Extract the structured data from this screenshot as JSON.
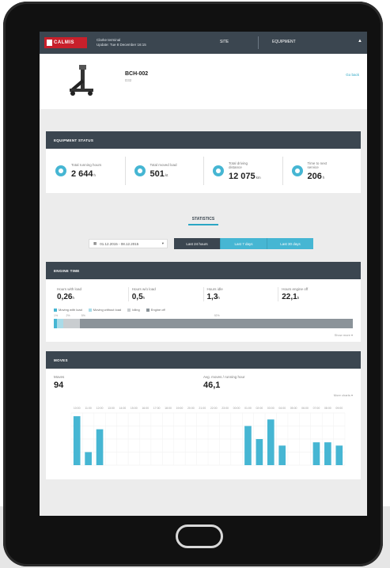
{
  "app": {
    "logo_text": "CALMIS",
    "site_name": "Clarke terminal",
    "site_updated": "Update: Tue 8 December 16:15",
    "nav": {
      "site": "SITE",
      "equipment": "EQUIPMENT"
    }
  },
  "equipment": {
    "id": "BCH-002",
    "model": "D32",
    "go_back": "Go back"
  },
  "status": {
    "title": "EQUIPMENT STATUS",
    "kpis": [
      {
        "label": "Total running hours",
        "value": "2 644",
        "unit": "h",
        "icon": "clock-icon"
      },
      {
        "label": "Total moved load",
        "value": "501",
        "unit": "kt",
        "icon": "load-icon"
      },
      {
        "label": "Total driving distance",
        "value": "12 075",
        "unit": "km",
        "icon": "distance-icon"
      },
      {
        "label": "Time to next service",
        "value": "206",
        "unit": "h",
        "icon": "service-icon"
      }
    ]
  },
  "statistics": {
    "title": "STATISTICS",
    "date_range": "01.12.2015 - 08.12.2015",
    "periods": [
      "Last 24 hours",
      "Last 7 days",
      "Last 30 days"
    ],
    "active_period": "Last 24 hours"
  },
  "engine_time": {
    "title": "ENGINE TIME",
    "kpis": [
      {
        "label": "Hours with load",
        "value": "0,26",
        "unit": "h"
      },
      {
        "label": "Hours w/o load",
        "value": "0,5",
        "unit": "h"
      },
      {
        "label": "Hours idle",
        "value": "1,3",
        "unit": "h"
      },
      {
        "label": "Hours engine off",
        "value": "22,1",
        "unit": "h"
      }
    ],
    "legend": [
      "Moving with load",
      "Moving without load",
      "Idling",
      "Engine off"
    ],
    "colors": [
      "#46b6d3",
      "#a9dbe8",
      "#c9cdd0",
      "#8b9399"
    ],
    "shares": [
      0.011,
      0.021,
      0.054,
      0.914
    ],
    "share_labels": [
      "1%",
      "2%",
      "5%",
      "92%"
    ],
    "show_more": "Show more"
  },
  "moves": {
    "title": "MOVES",
    "kpis": [
      {
        "label": "Moves",
        "value": "94"
      },
      {
        "label": "Avg. moves / running hour",
        "value": "46,1"
      }
    ],
    "more": "More charts",
    "chart_data": {
      "type": "bar",
      "categories": [
        "10:00",
        "11:00",
        "12:00",
        "13:00",
        "14:00",
        "15:00",
        "16:00",
        "17:00",
        "18:00",
        "19:00",
        "20:00",
        "21:00",
        "22:00",
        "23:00",
        "00:00",
        "01:00",
        "02:00",
        "03:00",
        "04:00",
        "05:00",
        "06:00",
        "07:00",
        "08:00",
        "09:00"
      ],
      "values": [
        15,
        4,
        11,
        0,
        0,
        0,
        0,
        0,
        0,
        0,
        0,
        0,
        0,
        0,
        0,
        12,
        8,
        14,
        6,
        0,
        0,
        7,
        7,
        6
      ],
      "ylim": [
        0,
        16
      ]
    }
  }
}
